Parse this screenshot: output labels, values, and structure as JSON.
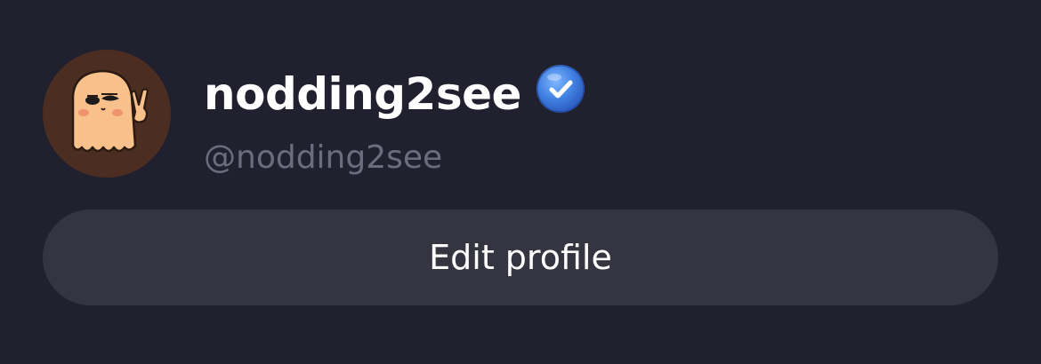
{
  "profile": {
    "display_name": "nodding2see",
    "handle": "@nodding2see",
    "verified": true,
    "avatar_icon": "ghost-peace-sign-avatar"
  },
  "actions": {
    "edit_profile_label": "Edit profile"
  },
  "colors": {
    "background": "#20202f",
    "button_bg": "#353542",
    "handle_text": "#6c6c7e",
    "badge_blue": "#3f7fe0"
  }
}
